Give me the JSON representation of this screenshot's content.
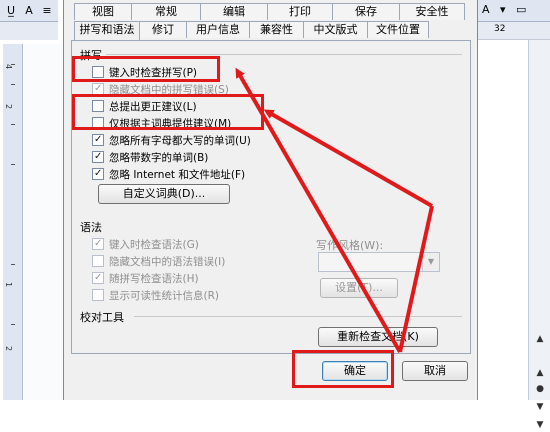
{
  "dialog": {
    "tabs_row1": [
      "视图",
      "常规",
      "编辑",
      "打印",
      "保存",
      "安全性"
    ],
    "tabs_row2": [
      "拼写和语法",
      "修订",
      "用户信息",
      "兼容性",
      "中文版式",
      "文件位置"
    ],
    "active_tab": "拼写和语法",
    "spelling": {
      "section_label": "拼写",
      "options": [
        {
          "label": "键入时检查拼写(P)",
          "checked": false,
          "disabled": false
        },
        {
          "label": "隐藏文档中的拼写错误(S)",
          "checked": true,
          "disabled": true
        },
        {
          "label": "总提出更正建议(L)",
          "checked": false,
          "disabled": false
        },
        {
          "label": "仅根据主词典提供建议(M)",
          "checked": false,
          "disabled": false
        },
        {
          "label": "忽略所有字母都大写的单词(U)",
          "checked": true,
          "disabled": false
        },
        {
          "label": "忽略带数字的单词(B)",
          "checked": true,
          "disabled": false
        },
        {
          "label": "忽略 Internet 和文件地址(F)",
          "checked": true,
          "disabled": false
        }
      ],
      "custom_dict_button": "自定义词典(D)..."
    },
    "grammar": {
      "section_label": "语法",
      "options": [
        {
          "label": "键入时检查语法(G)",
          "checked": true,
          "disabled": true
        },
        {
          "label": "隐藏文档中的语法错误(I)",
          "checked": false,
          "disabled": true
        },
        {
          "label": "随拼写检查语法(H)",
          "checked": true,
          "disabled": true
        },
        {
          "label": "显示可读性统计信息(R)",
          "checked": false,
          "disabled": true
        }
      ],
      "writing_style_label": "写作风格(W):",
      "writing_style_value": "",
      "settings_button": "设置(T)..."
    },
    "proofing": {
      "section_label": "校对工具",
      "recheck_button": "重新检查文档(K)"
    },
    "ok_button": "确定",
    "cancel_button": "取消"
  },
  "background": {
    "ruler_number": "32",
    "vruler_numbers": [
      "4",
      "2",
      "1",
      "2"
    ]
  },
  "annotation_color": "#e01a1a"
}
